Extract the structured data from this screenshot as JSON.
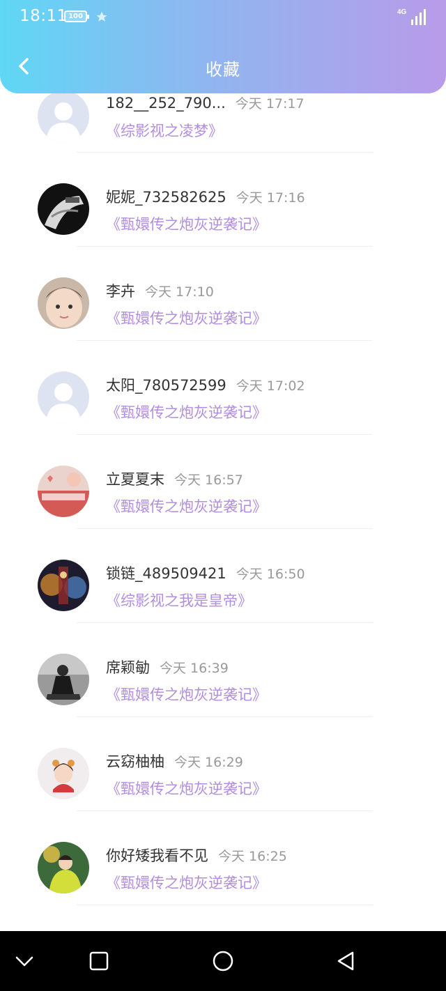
{
  "status": {
    "time": "18:11",
    "battery": "100",
    "network": "4G"
  },
  "header": {
    "title": "收藏"
  },
  "items": [
    {
      "name": "182__252_790...",
      "time": "今天 17:17",
      "book": "《综影视之凌梦》",
      "avatar": "default-avatar"
    },
    {
      "name": "妮妮_732582625",
      "time": "今天 17:16",
      "book": "《甄嬛传之炮灰逆袭记》",
      "avatar": "photo-avatar"
    },
    {
      "name": "李卉",
      "time": "今天 17:10",
      "book": "《甄嬛传之炮灰逆袭记》",
      "avatar": "photo-avatar"
    },
    {
      "name": "太阳_780572599",
      "time": "今天 17:02",
      "book": "《甄嬛传之炮灰逆袭记》",
      "avatar": "default-avatar"
    },
    {
      "name": "立夏夏末",
      "time": "今天 16:57",
      "book": "《甄嬛传之炮灰逆袭记》",
      "avatar": "photo-avatar"
    },
    {
      "name": "锁链_489509421",
      "time": "今天 16:50",
      "book": "《综影视之我是皇帝》",
      "avatar": "photo-avatar"
    },
    {
      "name": "席颖勄",
      "time": "今天 16:39",
      "book": "《甄嬛传之炮灰逆袭记》",
      "avatar": "photo-avatar"
    },
    {
      "name": "云窈柚柚",
      "time": "今天 16:29",
      "book": "《甄嬛传之炮灰逆袭记》",
      "avatar": "photo-avatar"
    },
    {
      "name": "你好矮我看不见",
      "time": "今天 16:25",
      "book": "《甄嬛传之炮灰逆袭记》",
      "avatar": "photo-avatar"
    }
  ],
  "navbar": {
    "icons": [
      "chevron-down-icon",
      "square-icon",
      "circle-icon",
      "triangle-back-icon"
    ]
  }
}
